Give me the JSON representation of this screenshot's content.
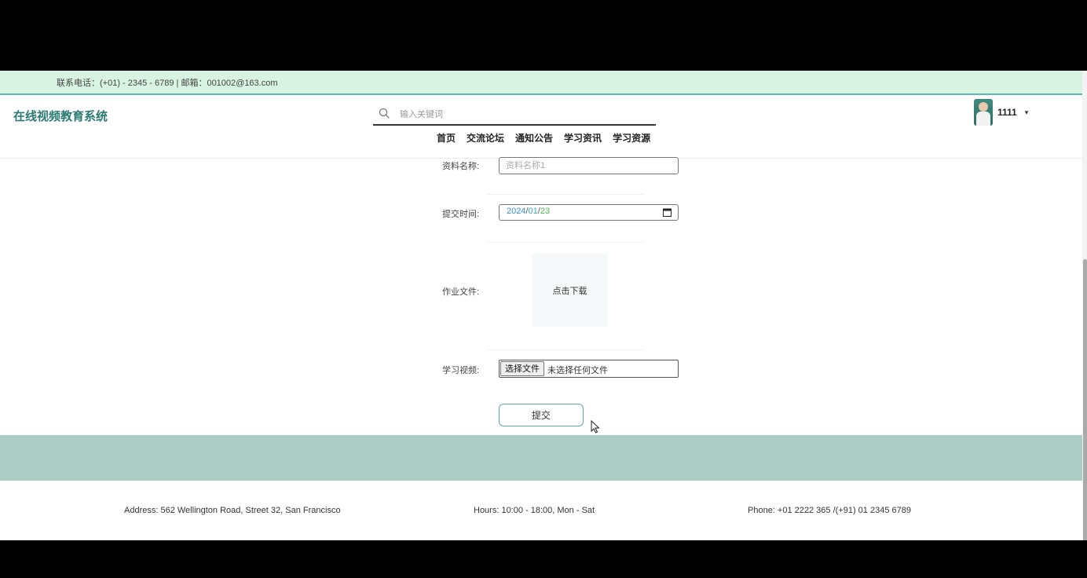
{
  "topbar": {
    "contact": "联系电话：(+01) - 2345 - 6789 | 邮箱：001002@163.com"
  },
  "header": {
    "logo": "在线视频教育系统",
    "search": {
      "placeholder": "输入关键词",
      "icon": "search-icon"
    },
    "nav": [
      "首页",
      "交流论坛",
      "通知公告",
      "学习资讯",
      "学习资源"
    ],
    "user": {
      "name": "1111",
      "caret": "▾"
    }
  },
  "form": {
    "name": {
      "label": "资料名称:",
      "placeholder": "资料名称1"
    },
    "date": {
      "label": "提交时间:",
      "year": "2024",
      "month": "01",
      "day": "23",
      "sep": "/"
    },
    "homework": {
      "label": "作业文件:",
      "download": "点击下载"
    },
    "video": {
      "label": "学习视频:",
      "button": "选择文件",
      "status": "未选择任何文件"
    },
    "submit": "提交"
  },
  "footer": {
    "address": "Address: 562 Wellington Road, Street 32, San Francisco",
    "hours": "Hours: 10:00 - 18:00, Mon - Sat",
    "phone": "Phone: +01 2222 365 /(+91) 01 2345 6789"
  },
  "colors": {
    "accent": "#2b7a72",
    "topbar": "#d8f3e2",
    "footer_band": "#acccc5"
  }
}
